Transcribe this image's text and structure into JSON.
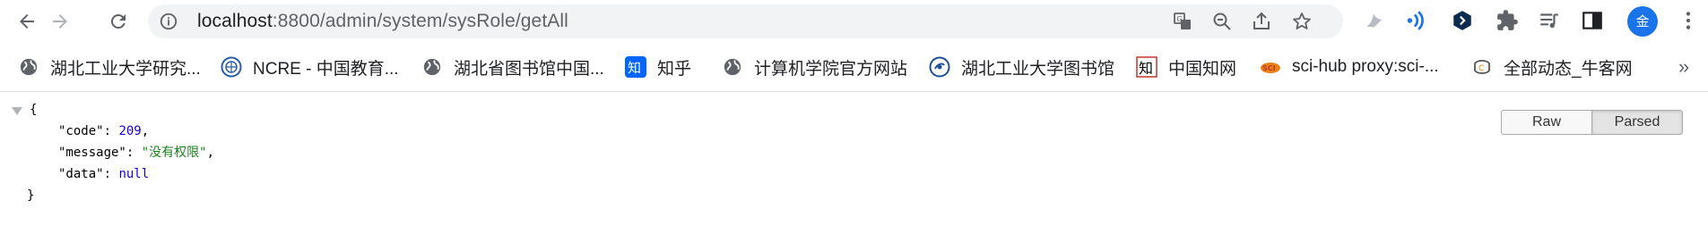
{
  "toolbar": {
    "url_host": "localhost",
    "url_rest": ":8800/admin/system/sysRole/getAll",
    "avatar_text": "金",
    "accent_color": "#1a73e8"
  },
  "bookmarks": [
    {
      "label": "湖北工业大学研究...",
      "icon": "globe-icon"
    },
    {
      "label": "NCRE - 中国教育...",
      "icon": "ncre-icon"
    },
    {
      "label": "湖北省图书馆中国...",
      "icon": "globe-icon"
    },
    {
      "label": "知乎",
      "icon": "zhihu-icon"
    },
    {
      "label": "计算机学院官方网站",
      "icon": "globe-icon"
    },
    {
      "label": "湖北工业大学图书馆",
      "icon": "library-icon"
    },
    {
      "label": "中国知网",
      "icon": "cnki-icon"
    },
    {
      "label": "sci-hub proxy:sci-...",
      "icon": "scihub-icon"
    },
    {
      "label": "全部动态_牛客网",
      "icon": "nowcoder-icon"
    }
  ],
  "bookmarks_more": "»",
  "json": {
    "open_brace": "{",
    "close_brace": "}",
    "lines": [
      {
        "key": "\"code\"",
        "sep": ": ",
        "value": "209",
        "comma": ","
      },
      {
        "key": "\"message\"",
        "sep": ": ",
        "value": "\"没有权限\"",
        "comma": ","
      },
      {
        "key": "\"data\"",
        "sep": ": ",
        "value": "null",
        "comma": ""
      }
    ]
  },
  "view_buttons": {
    "raw": "Raw",
    "parsed": "Parsed"
  }
}
